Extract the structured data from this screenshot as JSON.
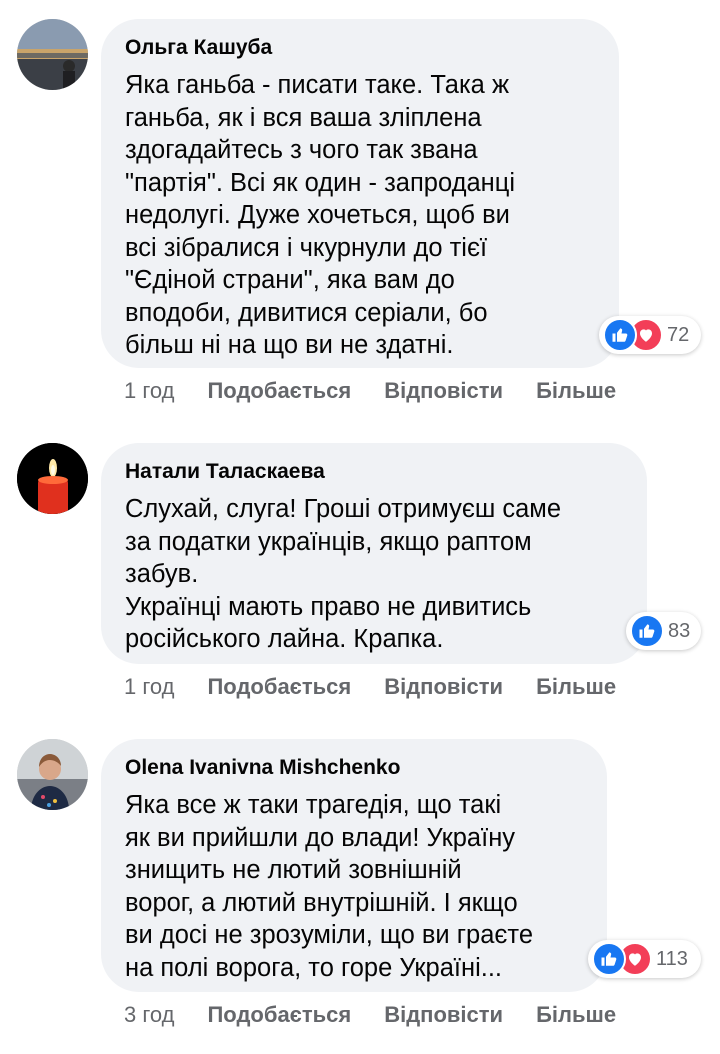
{
  "comments": [
    {
      "author": "Ольга Кашуба",
      "text": "Яка ганьба - писати таке. Така ж\nганьба, як і вся ваша зліплена\nздогадайтесь з чого так звана\n\"партія\". Всі як один - запроданці\nнедолугі. Дуже хочеться, щоб ви\nвсі зібралися і чкурнули до тієї\n\"Єдіной страни\", яка вам до\nвподоби, дивитися серіали, бо\nбільш ні на що ви не здатні.",
      "reactions": [
        "like-icon",
        "love-icon"
      ],
      "reaction_count": "72",
      "time": "1 год",
      "like_label": "Подобається",
      "reply_label": "Відповісти",
      "more_label": "Більше"
    },
    {
      "author": "Натали Таласкаева",
      "text": "Слухай, слуга! Гроші отримуєш саме\nза податки українців, якщо раптом\nзабув.\nУкраїнці мають право не дивитись\nросійського лайна. Крапка.",
      "reactions": [
        "like-icon"
      ],
      "reaction_count": "83",
      "time": "1 год",
      "like_label": "Подобається",
      "reply_label": "Відповісти",
      "more_label": "Більше"
    },
    {
      "author": "Olena Ivanivna Mishchenko",
      "text": "Яка все ж таки трагедія, що такі\nяк ви прийшли до влади! Україну\nзнищить не лютий зовнішній\nворог, а лютий внутрішній. І якщо\nви досі не зрозуміли, що ви граєте\nна полі ворога, то горе Україні...",
      "reactions": [
        "like-icon",
        "love-icon"
      ],
      "reaction_count": "113",
      "time": "3 год",
      "like_label": "Подобається",
      "reply_label": "Відповісти",
      "more_label": "Більше"
    }
  ],
  "colors": {
    "bubble": "#f0f2f5",
    "like": "#1877f2",
    "love": "#f33e58",
    "secondary_text": "#65676b"
  }
}
